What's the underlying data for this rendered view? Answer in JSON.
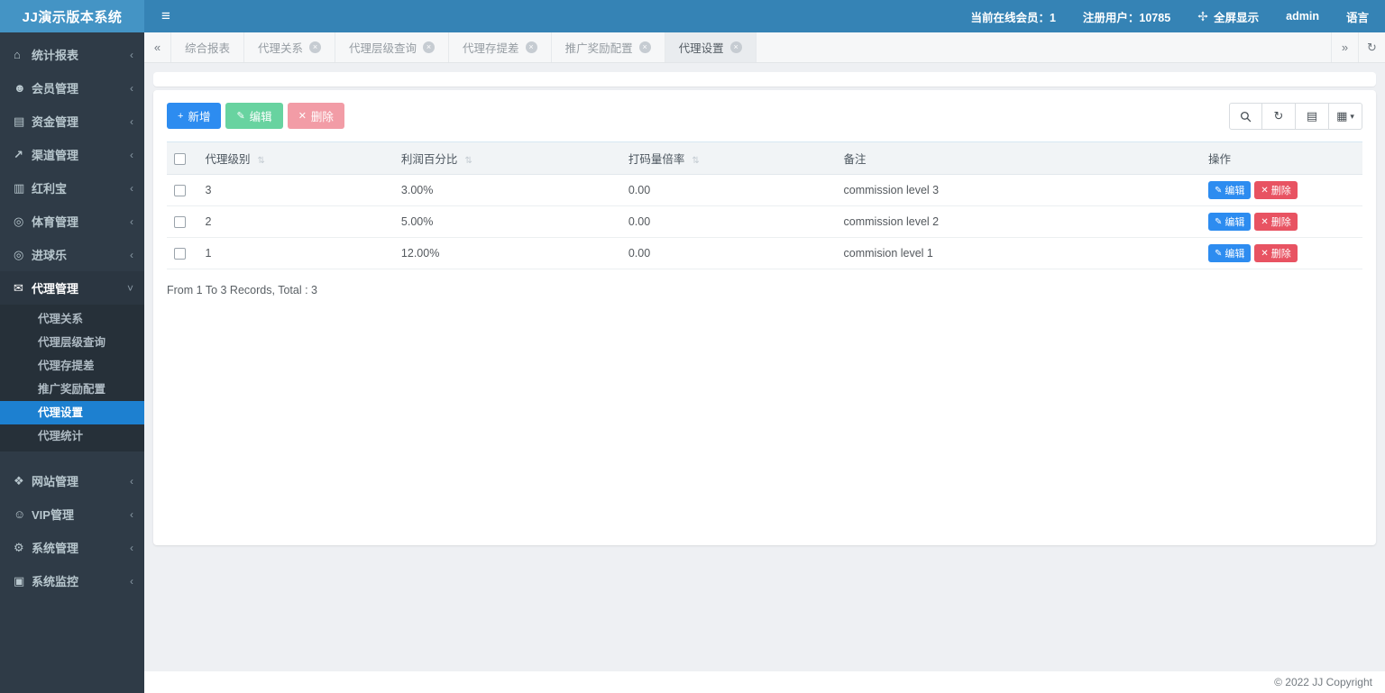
{
  "navbar": {
    "brand": "JJ演示版本系统",
    "menu_toggle_icon": "≡",
    "online_members": "当前在线会员：1",
    "registered_users": "注册用户：10785",
    "fullscreen_label": "全屏显示",
    "username": "admin",
    "language_label": "语言"
  },
  "sidebar": {
    "items": [
      {
        "label": "统计报表",
        "glyph": "⌂"
      },
      {
        "label": "会员管理",
        "glyph": "☻"
      },
      {
        "label": "资金管理",
        "glyph": "▤"
      },
      {
        "label": "渠道管理",
        "glyph": "↗"
      },
      {
        "label": "红利宝",
        "glyph": "▥"
      },
      {
        "label": "体育管理",
        "glyph": "◎"
      },
      {
        "label": "进球乐",
        "glyph": "◎"
      },
      {
        "label": "代理管理",
        "glyph": "✉"
      },
      {
        "label": "网站管理",
        "glyph": "❖"
      },
      {
        "label": "VIP管理",
        "glyph": "☺"
      },
      {
        "label": "系统管理",
        "glyph": "⚙"
      },
      {
        "label": "系统监控",
        "glyph": "▣"
      }
    ],
    "collapse_chevron": "‹",
    "expand_chevron": "˅",
    "agent_submenu": [
      "代理关系",
      "代理层级查询",
      "代理存提差",
      "推广奖励配置",
      "代理设置",
      "代理统计"
    ],
    "active_item": "代理设置"
  },
  "tabs": {
    "back_icon": "«",
    "forward_icon": "»",
    "refresh_icon": "↻",
    "close_icon": "×",
    "items": [
      {
        "label": "综合报表"
      },
      {
        "label": "代理关系"
      },
      {
        "label": "代理层级查询"
      },
      {
        "label": "代理存提差"
      },
      {
        "label": "推广奖励配置"
      },
      {
        "label": "代理设置"
      }
    ],
    "active_tab": "代理设置"
  },
  "toolbar": {
    "add_label": "新增",
    "add_icon": "+",
    "edit_label": "编辑",
    "edit_icon": "✎",
    "delete_label": "删除",
    "delete_icon": "✕",
    "refresh_icon": "↻",
    "detail_view_icon": "▤",
    "columns_icon": "▦",
    "caret_icon": "▾"
  },
  "table": {
    "columns": [
      "代理级别",
      "利润百分比",
      "打码量倍率",
      "备注",
      "操作"
    ],
    "sort_icon": "⇅",
    "rows": [
      {
        "level": "3",
        "profit_percent": "3.00%",
        "bet_multiple": "0.00",
        "remark": "commission level 3"
      },
      {
        "level": "2",
        "profit_percent": "5.00%",
        "bet_multiple": "0.00",
        "remark": "commission level 2"
      },
      {
        "level": "1",
        "profit_percent": "12.00%",
        "bet_multiple": "0.00",
        "remark": "commision level 1"
      }
    ],
    "row_actions": {
      "edit_label": "编辑",
      "edit_icon": "✎",
      "delete_label": "删除",
      "delete_icon": "✕"
    },
    "summary": "From 1 To 3 Records, Total : 3"
  },
  "footer": {
    "copyright": "© 2022 JJ Copyright"
  },
  "colors": {
    "navbar_bg": "#3583b5",
    "logo_bg": "#4494c5",
    "sidebar_bg": "#2f3b47",
    "submenu_bg": "#263039",
    "active_menu_blue": "#1d80d0",
    "primary_blue": "#2d8cf0",
    "edit_green": "#68d3a0",
    "delete_pink": "#f29ca6",
    "row_delete_red": "#e85362",
    "content_bg": "#eef0f3"
  }
}
